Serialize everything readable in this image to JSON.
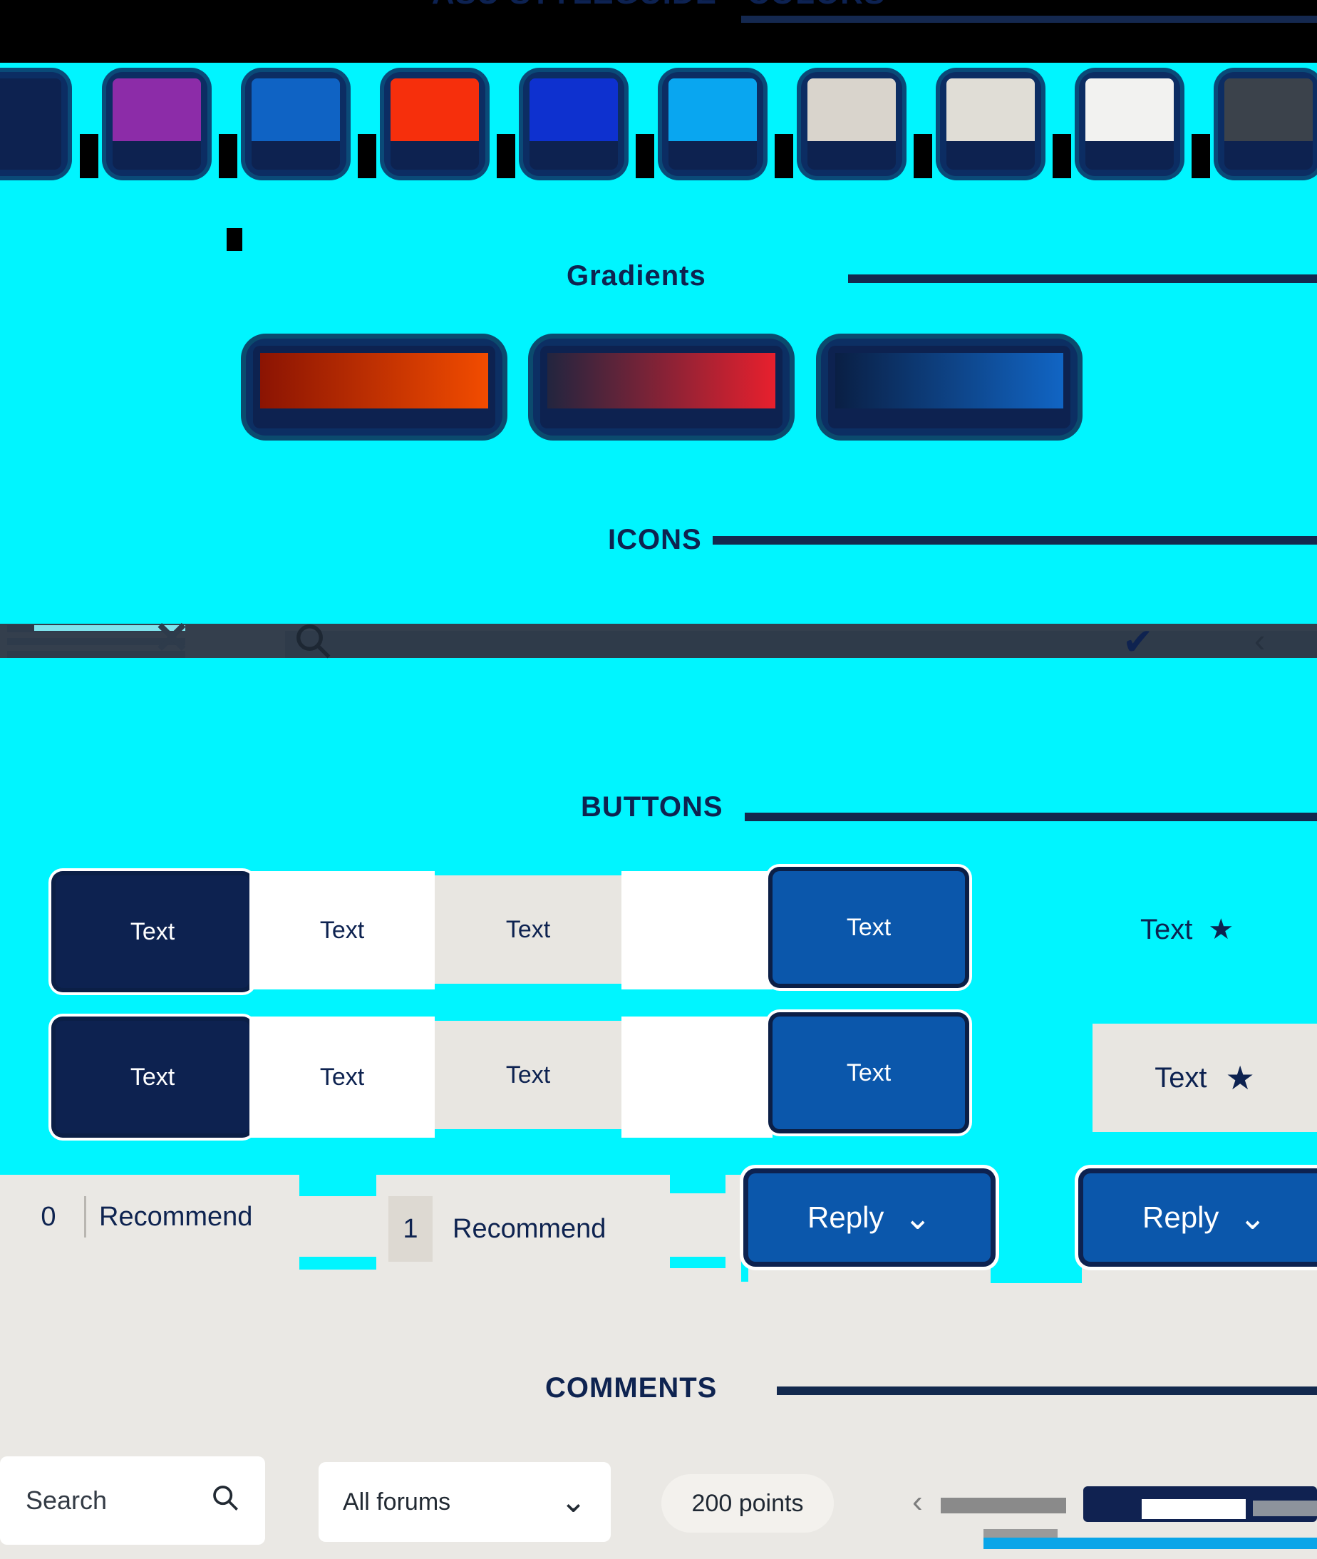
{
  "page": {
    "title": "ASU STYLEGUIDE - COLORS",
    "background_color": "#00f5ff",
    "panel_color": "#eae8e4",
    "black": "#000000"
  },
  "sections": [
    {
      "id": "colors",
      "heading": "COLORS"
    },
    {
      "id": "gradients",
      "heading": "Gradients"
    },
    {
      "id": "icons",
      "heading": "ICONS"
    },
    {
      "id": "buttons",
      "heading": "BUTTONS"
    },
    {
      "id": "comments",
      "heading": "COMMENTS"
    }
  ],
  "colors": {
    "swatches": [
      {
        "name": "asu-navy",
        "hex": "#0d2250"
      },
      {
        "name": "asu-magenta",
        "hex": "#8c2ca8"
      },
      {
        "name": "asu-blue",
        "hex": "#0f63c4"
      },
      {
        "name": "asu-red",
        "hex": "#f62f0c"
      },
      {
        "name": "asu-royal-blue",
        "hex": "#0e31cf"
      },
      {
        "name": "asu-sky",
        "hex": "#09a6f0"
      },
      {
        "name": "asu-warm-gray-1",
        "hex": "#d9d4cc"
      },
      {
        "name": "asu-warm-gray-2",
        "hex": "#e0ddd6"
      },
      {
        "name": "asu-white",
        "hex": "#f2f2f0"
      },
      {
        "name": "asu-dark-gray",
        "hex": "#3b424b"
      }
    ]
  },
  "gradients": {
    "swatches": [
      {
        "name": "maroon-to-orange",
        "from": "#8b1403",
        "to": "#f24c00"
      },
      {
        "name": "navy-to-red",
        "from": "#22253f",
        "to": "#e8202d"
      },
      {
        "name": "navy-to-blue",
        "from": "#0a1f44",
        "to": "#1165c4"
      }
    ]
  },
  "icons": {
    "items": [
      {
        "name": "hamburger-menu-icon",
        "glyph": "☰"
      },
      {
        "name": "close-icon",
        "glyph": "✕"
      },
      {
        "name": "search-icon",
        "glyph": "⚲"
      },
      {
        "name": "check-icon",
        "glyph": "✔"
      },
      {
        "name": "chevron-left-icon",
        "glyph": "‹"
      }
    ]
  },
  "buttons": {
    "label": "Text",
    "row1": [
      {
        "name": "primary-navy-button",
        "label": "Text",
        "style": "navy"
      },
      {
        "name": "white-button",
        "label": "Text",
        "style": "white"
      },
      {
        "name": "gray-button",
        "label": "Text",
        "style": "gray"
      },
      {
        "name": "primary-blue-button",
        "label": "Text",
        "style": "blue"
      }
    ],
    "row2": [
      {
        "name": "primary-navy-button",
        "label": "Text",
        "style": "navy"
      },
      {
        "name": "white-button",
        "label": "Text",
        "style": "white"
      },
      {
        "name": "gray-button",
        "label": "Text",
        "style": "gray"
      },
      {
        "name": "primary-blue-button",
        "label": "Text",
        "style": "blue"
      }
    ],
    "star_button": {
      "label": "Text",
      "icon": "star-icon",
      "glyph": "★"
    },
    "star_button_clipped": {
      "label": "Text",
      "icon": "star-icon",
      "glyph": "★"
    }
  },
  "comments": {
    "recommend_label": "Recommend",
    "items": [
      {
        "count": "0",
        "label": "Recommend"
      },
      {
        "count": "1",
        "label": "Recommend"
      }
    ],
    "reply": [
      {
        "label": "Reply",
        "caret": "⌄"
      },
      {
        "label": "Reply",
        "caret": "⌄"
      }
    ]
  },
  "toolbar": {
    "search": {
      "placeholder": "Search",
      "value": "Search",
      "icon": "search-icon",
      "glyph": "⚲"
    },
    "forum_select": {
      "value": "All forums",
      "caret": "⌄"
    },
    "points_badge": "200 points",
    "pager": {
      "prev": "‹"
    }
  }
}
